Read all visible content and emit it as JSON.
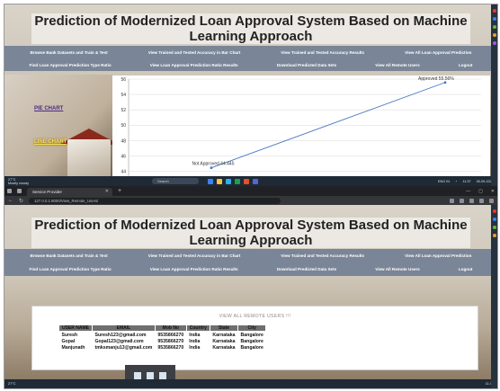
{
  "app": {
    "title": "Prediction of Modernized Loan Approval System Based on Machine Learning Approach"
  },
  "nav": {
    "row1": [
      "Browse Bank Datasets and Train & Test",
      "View Trained and Tested Accuracy in Bar Chart",
      "View Trained and Tested Accuracy Results",
      "View All Loan Approval Prediction"
    ],
    "row2": [
      "Find Loan Approval Prediction Type Ratio",
      "View Loan Approval Prediction Ratio Results",
      "Download Predicted Data Sets",
      "View All Remote Users",
      "Logout"
    ]
  },
  "side_links": {
    "pie": "PIE CHART",
    "line": "LINE CHART"
  },
  "chart_data": {
    "type": "line",
    "x": [
      "Not Approved",
      "Approved"
    ],
    "values": [
      44.44,
      55.56
    ],
    "annotations": [
      "Not Approved 44.445",
      "Approved 55.56%"
    ],
    "ylim": [
      43,
      56
    ],
    "yticks": [
      44,
      46,
      48,
      50,
      52,
      54,
      56
    ],
    "grid": true,
    "line_color": "#4a78c2"
  },
  "taskbar_top": {
    "weather": "27°C",
    "weather_sub": "Mostly cloudy",
    "search": "Search",
    "lang": "ENG\nIN",
    "time": "11:37",
    "date": "26-09-2023"
  },
  "browser": {
    "tab_title": "Service Provider",
    "new_tab": "+",
    "url": "127.0.0.1:8000/View_Remote_Users/"
  },
  "remote_users": {
    "title": "VIEW ALL REMOTE USERS !!!",
    "headers": [
      "USER NAME",
      "EMAIL",
      "Mob No",
      "Country",
      "State",
      "City"
    ],
    "rows": [
      [
        "Suresh",
        "Suresh123@gmail.com",
        "9535866270",
        "India",
        "Karnataka",
        "Bangalore"
      ],
      [
        "Gopal",
        "Gopal123@gmail.com",
        "9535866270",
        "India",
        "Karnataka",
        "Bangalore"
      ],
      [
        "Manjunath",
        "tmksmanju13@gmail.com",
        "9535866270",
        "India",
        "Karnataka",
        "Bangalore"
      ]
    ]
  },
  "taskbar_bottom": {
    "weather": "27°C",
    "time": "11:37"
  },
  "colors": {
    "nav_bg": "#7a8597",
    "taskbar": "#1f2a36"
  }
}
